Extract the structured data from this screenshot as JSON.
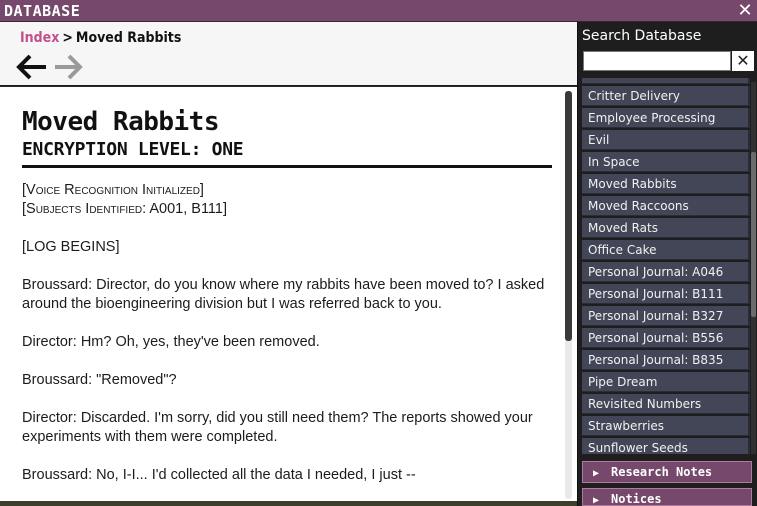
{
  "window": {
    "title": "DATABASE",
    "close_glyph": "✕"
  },
  "breadcrumb": {
    "link": "Index",
    "separator": ">",
    "current": "Moved Rabbits"
  },
  "nav": {
    "back_icon": "arrow-left-icon",
    "forward_icon": "arrow-right-icon",
    "forward_enabled": false
  },
  "document": {
    "title": "Moved Rabbits",
    "encryption": "ENCRYPTION LEVEL: ONE",
    "lines": {
      "voice": "[Voice Recognition Initialized]",
      "subjects": "[Subjects Identified: A001, B111]",
      "log": "[LOG BEGINS]",
      "p1": "Broussard: Director, do you know where my rabbits have been moved to? I asked around the bioengineering division but I was referred back to you.",
      "p2": "Director: Hm? Oh, yes, they've been removed.",
      "p3": "Broussard: \"Removed\"?",
      "p4": "Director: Discarded. I'm sorry, did you still need them? The reports showed your experiments with them were completed.",
      "p5": "Broussard: No, I-I... I'd collected all the data I needed, I just --"
    }
  },
  "sidebar": {
    "heading": "Search Database",
    "search": {
      "value": "",
      "clear_glyph": "✕"
    },
    "items": [
      "Critter Delivery",
      "Employee Processing",
      "Evil",
      "In Space",
      "Moved Rabbits",
      "Moved Raccoons",
      "Moved Rats",
      "Office Cake",
      "Personal Journal: A046",
      "Personal Journal: B111",
      "Personal Journal: B327",
      "Personal Journal: B556",
      "Personal Journal: B835",
      "Pipe Dream",
      "Revisited Numbers",
      "Strawberries",
      "Sunflower Seeds"
    ],
    "sections": [
      "Research Notes",
      "Notices"
    ],
    "section_glyph": "▶"
  },
  "colors": {
    "accent": "#76486b",
    "link": "#c2508e",
    "list_item": "#434657"
  }
}
